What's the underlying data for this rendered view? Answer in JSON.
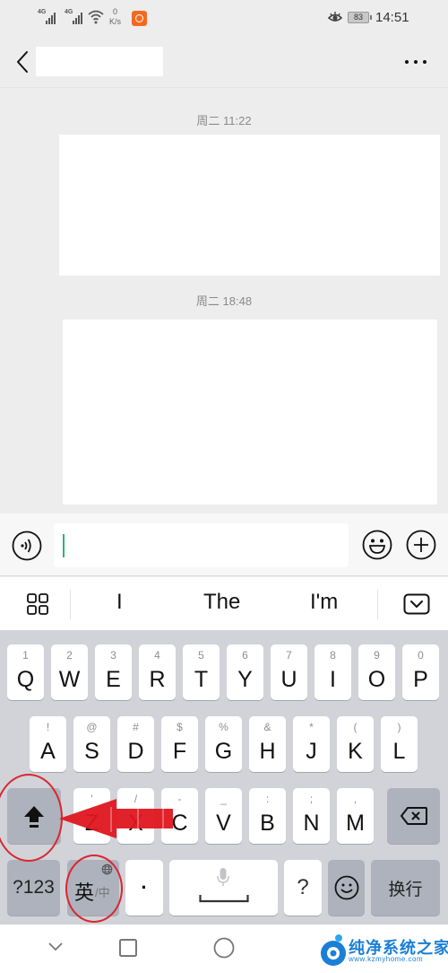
{
  "status_bar": {
    "signal_1_label": "4G",
    "signal_2_label": "4G",
    "net_speed_value": "0",
    "net_speed_unit": "K/s",
    "battery_level": "83",
    "time": "14:51"
  },
  "header": {
    "title": "",
    "back_icon": "chevron-left-icon",
    "more_icon": "more-dots-icon"
  },
  "chat": {
    "messages": [
      {
        "timestamp": "周二 11:22"
      },
      {
        "timestamp": "周二 18:48"
      }
    ]
  },
  "input_bar": {
    "value": "",
    "voice_icon": "voice-icon",
    "emoji_icon": "emoji-icon",
    "plus_icon": "plus-icon"
  },
  "suggestions": {
    "menu_icon": "grid-icon",
    "items": [
      "I",
      "The",
      "I'm"
    ],
    "collapse_icon": "keyboard-collapse-icon"
  },
  "keyboard": {
    "row1": [
      {
        "hint": "1",
        "key": "Q"
      },
      {
        "hint": "2",
        "key": "W"
      },
      {
        "hint": "3",
        "key": "E"
      },
      {
        "hint": "4",
        "key": "R"
      },
      {
        "hint": "5",
        "key": "T"
      },
      {
        "hint": "6",
        "key": "Y"
      },
      {
        "hint": "7",
        "key": "U"
      },
      {
        "hint": "8",
        "key": "I"
      },
      {
        "hint": "9",
        "key": "O"
      },
      {
        "hint": "0",
        "key": "P"
      }
    ],
    "row2": [
      {
        "hint": "!",
        "key": "A"
      },
      {
        "hint": "@",
        "key": "S"
      },
      {
        "hint": "#",
        "key": "D"
      },
      {
        "hint": "$",
        "key": "F"
      },
      {
        "hint": "%",
        "key": "G"
      },
      {
        "hint": "&",
        "key": "H"
      },
      {
        "hint": "*",
        "key": "J"
      },
      {
        "hint": "(",
        "key": "K"
      },
      {
        "hint": ")",
        "key": "L"
      }
    ],
    "row3": [
      {
        "hint": "'",
        "key": "Z"
      },
      {
        "hint": "/",
        "key": "X"
      },
      {
        "hint": "-",
        "key": "C"
      },
      {
        "hint": "_",
        "key": "V"
      },
      {
        "hint": ":",
        "key": "B"
      },
      {
        "hint": ";",
        "key": "N"
      },
      {
        "hint": ",",
        "key": "M"
      }
    ],
    "symbols_label": "?123",
    "lang_primary": "英",
    "lang_secondary": "/中",
    "period_label": "·",
    "question_label": "?",
    "enter_label": "换行"
  },
  "annotation": {
    "color": "#d9262f",
    "arrow_target": "shift-key"
  },
  "watermark": {
    "title": "纯净系统之家",
    "url": "www.kzmyhome.com"
  }
}
